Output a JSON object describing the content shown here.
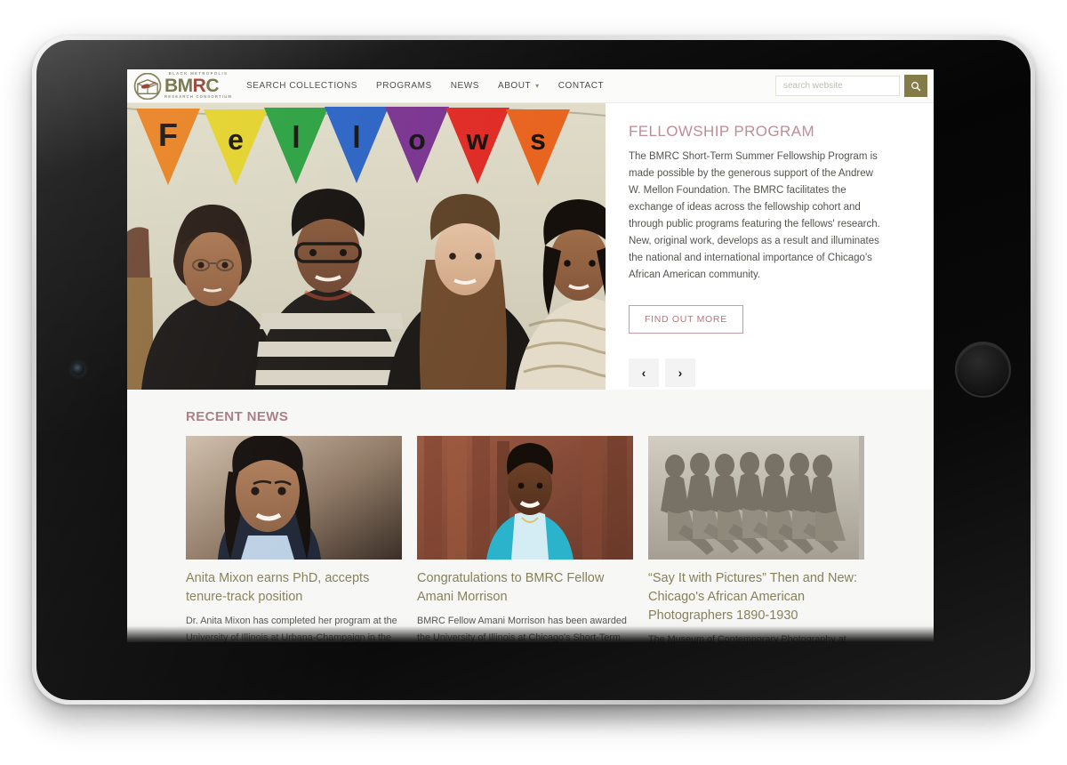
{
  "device": {
    "type": "tablet",
    "orientation": "landscape"
  },
  "site": {
    "logo": {
      "top_text": "BLACK METROPOLIS",
      "main_text": "BMRC",
      "bottom_text": "RESEARCH CONSORTIUM",
      "mark_icon": "archive-box-icon",
      "accent_color": "#9e3b2e",
      "primary_color": "#6f7042"
    },
    "nav": [
      {
        "label": "SEARCH COLLECTIONS",
        "has_dropdown": false
      },
      {
        "label": "PROGRAMS",
        "has_dropdown": false
      },
      {
        "label": "NEWS",
        "has_dropdown": false
      },
      {
        "label": "ABOUT",
        "has_dropdown": true,
        "caret": "▾"
      },
      {
        "label": "CONTACT",
        "has_dropdown": false
      }
    ],
    "search": {
      "placeholder": "search website",
      "value": "",
      "button_icon": "search-icon",
      "button_color": "#847c48"
    }
  },
  "hero": {
    "title": "FELLOWSHIP PROGRAM",
    "title_color": "#c28c94",
    "body": "The BMRC Short-Term Summer Fellowship Program is made possible by the generous support of the Andrew W. Mellon Foundation. The BMRC facilitates the exchange of ideas across the fellowship cohort and through public programs featuring the fellows' research. New, original work, develops as a result and illuminates the national and international importance of Chicago's African American community.",
    "cta_label": "FIND OUT MORE",
    "cta_color": "#b8737d",
    "carousel": {
      "prev_icon": "chevron-left-icon",
      "prev_glyph": "‹",
      "next_icon": "chevron-right-icon",
      "next_glyph": "›"
    },
    "image": {
      "alt": "Four BMRC fellows standing in front of a wall with colorful bunting flags spelling Fellows",
      "bunting_letters": [
        "F",
        "e",
        "l",
        "l",
        "o",
        "w",
        "s"
      ],
      "bunting_colors": [
        "#e8801f",
        "#e4d22a",
        "#2aa03f",
        "#2a63c4",
        "#7a3390",
        "#e02a25",
        "#e8641f"
      ]
    }
  },
  "news": {
    "heading": "RECENT NEWS",
    "heading_color": "#a77b84",
    "link_color": "#86815b",
    "cards": [
      {
        "title": "Anita Mixon earns PhD, accepts tenure-track position",
        "excerpt": "Dr. Anita Mixon has completed her program at the University of Illinois at Urbana-Champaign in the Department of Communication, and has",
        "image_alt": "Portrait of a smiling woman with long dark hair in a dark blazer and light blue shirt"
      },
      {
        "title": "Congratulations to BMRC Fellow Amani Morrison",
        "excerpt": "BMRC Fellow Amani Morrison has been awarded the University of Illinois at Chicago's Short-Term Travel Fellowship.",
        "image_alt": "Smiling woman in a turquoise cardigan standing in front of a weathered red wooden door"
      },
      {
        "title": "“Say It with Pictures” Then and New: Chicago's African American Photographers 1890-1930",
        "excerpt": "The Museum of Contemporary Photography at Columbia College Chicago will host a multi-tiered",
        "image_alt": "Vintage black and white photograph of a chorus line of dancers posed in a row"
      }
    ]
  }
}
